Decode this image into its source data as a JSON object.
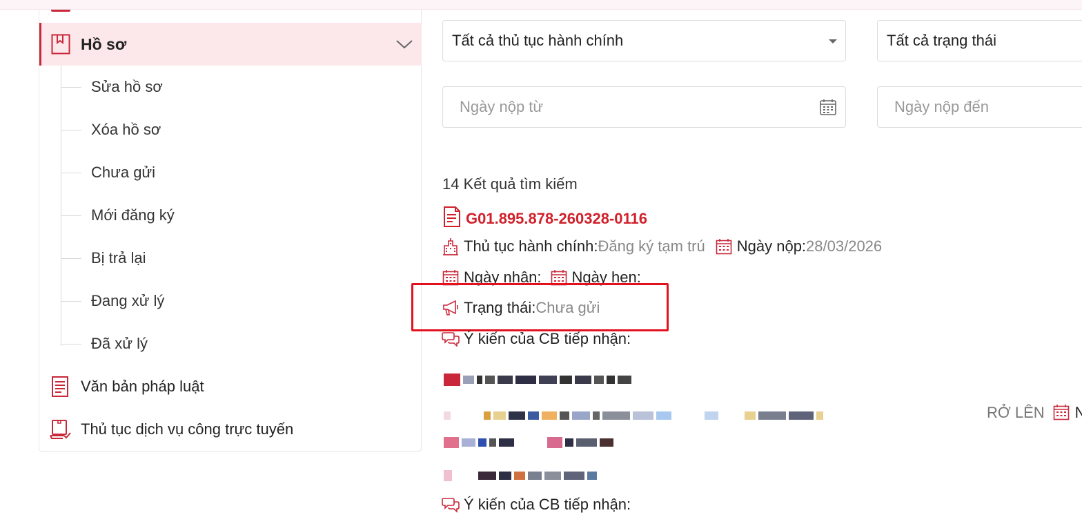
{
  "sidebar": {
    "active_menu": {
      "label": "Hồ sơ",
      "icon": "bookmark-icon"
    },
    "sub_items": [
      {
        "label": "Sửa hồ sơ"
      },
      {
        "label": "Xóa hồ sơ"
      },
      {
        "label": "Chưa gửi"
      },
      {
        "label": "Mới đăng ký"
      },
      {
        "label": "Bị trả lại"
      },
      {
        "label": "Đang xử lý"
      },
      {
        "label": "Đã xử lý"
      }
    ],
    "menu_items": [
      {
        "label": "Văn bản pháp luật",
        "icon": "document-icon"
      },
      {
        "label": "Thủ tục dịch vụ công trực tuyến",
        "icon": "laptop-check-icon"
      }
    ]
  },
  "filters": {
    "procedure_select": "Tất cả thủ tục hành chính",
    "status_select": "Tất cả trạng thái",
    "date_from_placeholder": "Ngày nộp từ",
    "date_to_placeholder": "Ngày nộp đến"
  },
  "results": {
    "count_text": "14 Kết quả tìm kiếm",
    "record": {
      "code": "G01.895.878-260328-0116",
      "procedure_label": "Thủ tục hành chính:",
      "procedure_value": "Đăng ký tạm trú",
      "submit_date_label": "Ngày nộp:",
      "submit_date_value": "28/03/2026",
      "received_date_label": "Ngày nhận:",
      "appointment_date_label": "Ngày hẹn:",
      "status_label": "Trạng thái:",
      "status_value": "Chưa gửi",
      "comment_label": "Ý kiến của CB tiếp nhận:"
    },
    "next_record": {
      "partial_text": "RỞ LÊN",
      "partial_label": "N",
      "comment_label": "Ý kiến của CB tiếp nhận:"
    }
  },
  "colors": {
    "accent": "#c9283a",
    "code_red": "#d0212b",
    "highlight_border": "#e3101e",
    "active_bg": "#fce8ea",
    "muted_value": "#888888"
  }
}
